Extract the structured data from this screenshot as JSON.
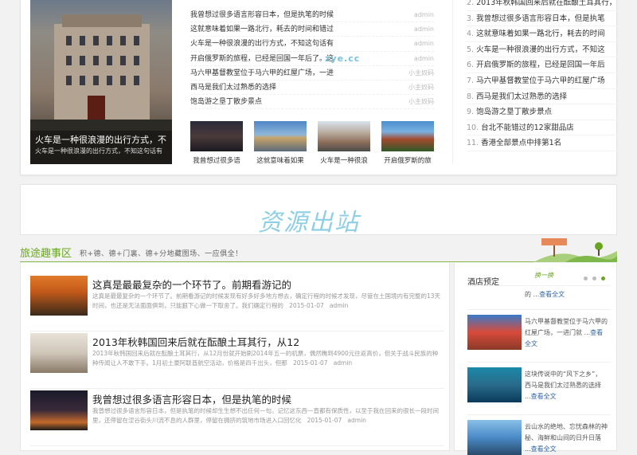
{
  "hero": {
    "title": "火车是一种很浪漫的出行方式，不",
    "subtitle": "火车是一种很浪漫的出行方式，不知这句话有"
  },
  "top_list": [
    {
      "title": "我曾想过很多语言形容日本，但是执笔的时候",
      "author": "admin"
    },
    {
      "title": "这就意味着如果一路北行，耗去的时间和错过",
      "author": "admin"
    },
    {
      "title": "火车是一种很浪漫的出行方式，不知这句话有",
      "author": "admin"
    },
    {
      "title": "开启俄罗斯的旅程，已经是回国一年后了。这",
      "author": "admin"
    },
    {
      "title": "马六甲基督教堂位于马六甲的红屋广场，一进",
      "author": "小主奴码"
    },
    {
      "title": "西马是我们太过熟悉的选择",
      "author": "小主奴码"
    },
    {
      "title": "饱岛游之垦丁散步景点",
      "author": "小主奴码"
    }
  ],
  "thumbs": [
    {
      "caption": "我曾想过很多语"
    },
    {
      "caption": "这就意味着如果"
    },
    {
      "caption": "火车是一种很浪"
    },
    {
      "caption": "开启俄罗斯的旅"
    }
  ],
  "ranking": [
    {
      "num": "2.",
      "title": "2013年秋韩国回来后就在酝酿土耳其行，"
    },
    {
      "num": "3.",
      "title": "我曾想过很多语言形容日本，但是执笔"
    },
    {
      "num": "4.",
      "title": "这就意味着如果一路北行，耗去的时间"
    },
    {
      "num": "5.",
      "title": "火车是一种很浪漫的出行方式，不知这"
    },
    {
      "num": "6.",
      "title": "开启俄罗斯的旅程，已经是回国一年后"
    },
    {
      "num": "7.",
      "title": "马六甲基督教堂位于马六甲的红屋广场"
    },
    {
      "num": "8.",
      "title": "西马是我们太过熟悉的选择"
    },
    {
      "num": "9.",
      "title": "饱岛游之垦丁散步景点"
    },
    {
      "num": "10.",
      "title": "台北不能错过的12家甜品店"
    },
    {
      "num": "11.",
      "title": "香港全部景点中排第1名"
    }
  ],
  "ad": {
    "logo": "资源出站",
    "url": "zye.cc"
  },
  "section": {
    "title": "旅途趣事区",
    "slogan": "积+德、德+门裏、德+分地藏图场、一应俱全！"
  },
  "articles": [
    {
      "title": "这真是最最复杂的一个环节了。前期看游记的",
      "desc": "这真是最最复杂的一个环节了。前期看游记的时候发现有好多好多地方想去，确定行程的时候才发现，尽管在土国境内有完整的13天时间，也还是无法面面俱到，只能狠下心做一下取舍了。我们确定行程的",
      "date": "2015-01-07",
      "author": "admin"
    },
    {
      "title": "2013年秋韩国回来后就在酝酿土耳其行，从12",
      "desc": "2013年秋韩国回来后就在酝酿土耳其行，从12月份就开始刷2014年五一的机票，偶然瞧到4900元往返高价，但关于战斗民族的种种传闻让人不敢下手。1月初土豪阿联酋航空活动，价格是四千出头，但那",
      "date": "2015-01-07",
      "author": "admin"
    },
    {
      "title": "我曾想过很多语言形容日本，但是执笔的时候",
      "desc": "我曾想过很多语言形容日本，但是执笔的时候却生生想不出任何一句。记忆这东西一直都有保质性，以至于我在回来的很长一段时间里，还停留在涩谷街头川流不息的人群里，停留在拥挤的筑地市场进入口回忆化",
      "date": "2015-01-07",
      "author": "admin"
    }
  ],
  "sidebar": {
    "title": "酒店预定",
    "swap": "换一换",
    "more": "查看全文",
    "items": [
      {
        "text": "的 ..."
      },
      {
        "text": "马六甲基督教堂位于马六甲的红屋广场，一进门就 ..."
      },
      {
        "text": "这块传说中的“风下之乡”，西马是我们太过熟悉的选择 ..."
      },
      {
        "text": "云山水的绝地、忘忧森林的神秘、海鲜和山间的日升日落 ..."
      }
    ]
  }
}
